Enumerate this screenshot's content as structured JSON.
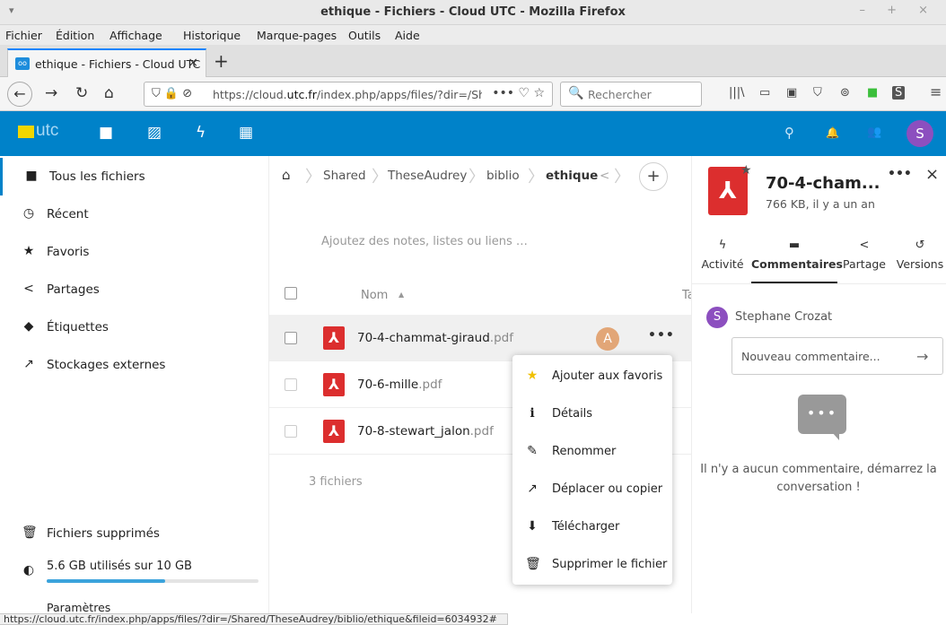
{
  "window": {
    "title": "ethique - Fichiers - Cloud UTC - Mozilla Firefox",
    "wm_left": "▾",
    "wm_right": "– + ×"
  },
  "menu": [
    "Fichier",
    "Édition",
    "Affichage",
    "Historique",
    "Marque-pages",
    "Outils",
    "Aide"
  ],
  "tab": {
    "label": "ethique - Fichiers - Cloud UTC",
    "close": "×",
    "favicon": "oo"
  },
  "newtab": "+",
  "nav": {
    "back": "←",
    "forward": "→",
    "reload": "↻",
    "home": "⌂",
    "url_icons": "⛉ 🔒 ⊘",
    "url_prefix": "https://cloud.",
    "url_domain": "utc.fr",
    "url_rest": "/index.php/apps/files/?dir=/Shar",
    "url_right": "••• ♡ ☆",
    "search_placeholder": "Rechercher",
    "search_icon": "🔍",
    "toolbar_icons": [
      "|||\\",
      "▭",
      "▣",
      "⛉",
      "⊚",
      "■",
      "S",
      "≡"
    ]
  },
  "nc_header": {
    "logo_text": "utc",
    "apps": [
      "■",
      "▨",
      "ϟ",
      "▦"
    ],
    "right_icons": [
      "⚲",
      "🔔",
      "👥"
    ],
    "avatar": "S"
  },
  "sidebar": {
    "items": [
      {
        "icon": "■",
        "label": "Tous les fichiers"
      },
      {
        "icon": "◷",
        "label": "Récent"
      },
      {
        "icon": "★",
        "label": "Favoris"
      },
      {
        "icon": "<",
        "label": "Partages"
      },
      {
        "icon": "◆",
        "label": "Étiquettes"
      },
      {
        "icon": "↗",
        "label": "Stockages externes"
      }
    ],
    "trash": {
      "icon": "🗑",
      "label": "Fichiers supprimés"
    },
    "quota": {
      "icon": "◐",
      "label": "5.6 GB utilisés sur 10 GB",
      "fraction": 0.56
    },
    "settings": "Paramètres"
  },
  "breadcrumb": {
    "home": "⌂",
    "parts": [
      "Shared",
      "TheseAudrey",
      "biblio",
      "ethique"
    ],
    "share_icon": "<",
    "add": "+"
  },
  "notes_placeholder": "Ajoutez des notes, listes ou liens …",
  "columns": {
    "name": "Nom",
    "sort": "▲",
    "size_cut": "Ta"
  },
  "files": [
    {
      "name": "70-4-chammat-giraud",
      "ext": ".pdf",
      "shared_avatar": "A",
      "more": "•••"
    },
    {
      "name": "70-6-mille",
      "ext": ".pdf"
    },
    {
      "name": "70-8-stewart_jalon",
      "ext": ".pdf"
    }
  ],
  "file_count": "3 fichiers",
  "context_menu": [
    {
      "icon": "★",
      "label": "Ajouter aux favoris"
    },
    {
      "icon": "i",
      "label": "Détails"
    },
    {
      "icon": "✎",
      "label": "Renommer"
    },
    {
      "icon": "↗",
      "label": "Déplacer ou copier"
    },
    {
      "icon": "⬇",
      "label": "Télécharger"
    },
    {
      "icon": "🗑",
      "label": "Supprimer le fichier"
    }
  ],
  "details": {
    "title": "70-4-cham...",
    "subtitle": "766 KB, il y a un an",
    "star": "★",
    "more": "•••",
    "close": "×",
    "tabs": [
      {
        "icon": "ϟ",
        "label": "Activité"
      },
      {
        "icon": "▬",
        "label": "Commentaires"
      },
      {
        "icon": "<",
        "label": "Partage"
      },
      {
        "icon": "↺",
        "label": "Versions"
      }
    ],
    "comment_user_avatar": "S",
    "comment_user": "Stephane Crozat",
    "comment_placeholder": "Nouveau commentaire...",
    "send": "→",
    "empty_icon": "•••",
    "empty_message": "Il n'y a aucun commentaire, démarrez la conversation !"
  },
  "statusbar": "https://cloud.utc.fr/index.php/apps/files/?dir=/Shared/TheseAudrey/biblio/ethique&fileid=6034932#",
  "colors": {
    "nc_blue": "#0082c9",
    "pdf_red": "#dc2e2e",
    "avatar_purple": "#8c4fbf",
    "avatar_orange": "#e2a677",
    "firefox_tab": "#0a84ff"
  }
}
